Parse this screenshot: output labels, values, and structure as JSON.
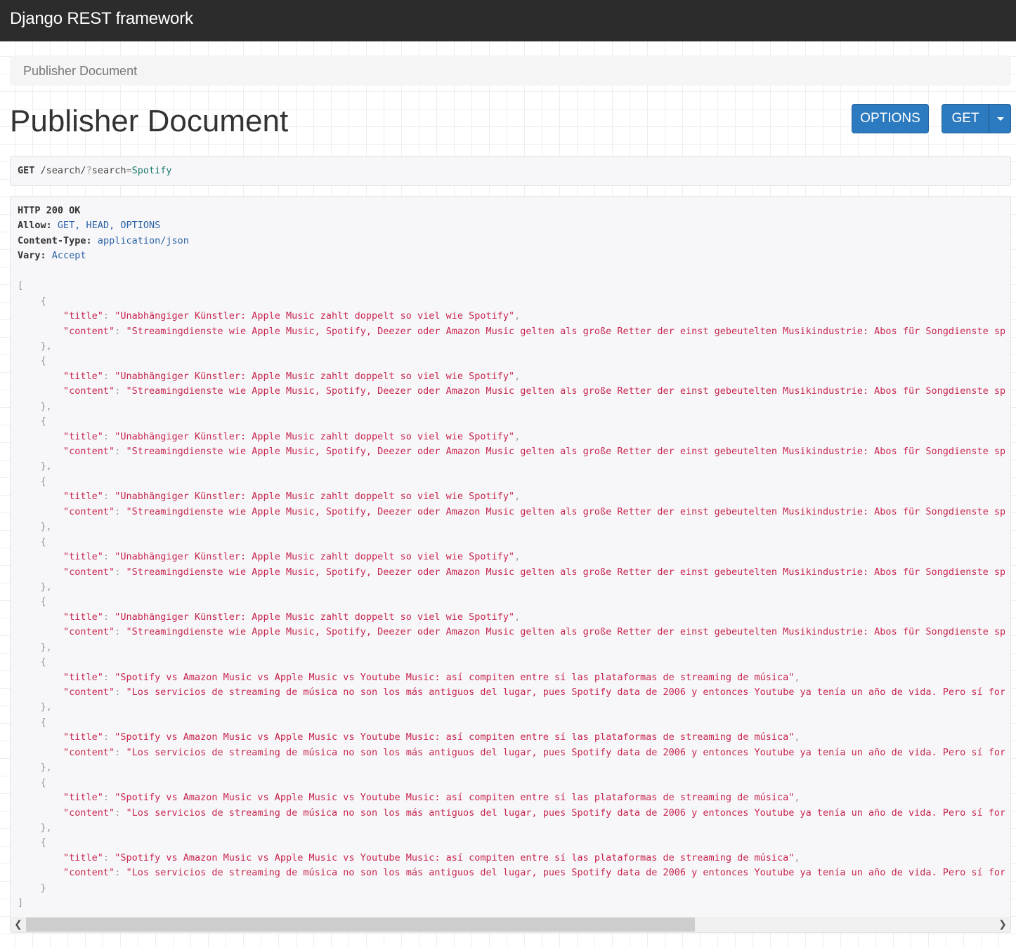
{
  "navbar": {
    "brand": "Django REST framework"
  },
  "breadcrumb": {
    "current": "Publisher Document"
  },
  "page": {
    "title": "Publisher Document"
  },
  "buttons": {
    "options_label": "OPTIONS",
    "get_label": "GET",
    "caret_icon": "caret-down-icon"
  },
  "request": {
    "method": "GET",
    "path_prefix": "/search/",
    "query_q": "?",
    "query_key": "search",
    "query_eq": "=",
    "query_value": "Spotify"
  },
  "response": {
    "status_line": "HTTP 200 OK",
    "headers": [
      {
        "key": "Allow:",
        "value": "GET, HEAD, OPTIONS"
      },
      {
        "key": "Content-Type:",
        "value": "application/json"
      },
      {
        "key": "Vary:",
        "value": "Accept"
      }
    ],
    "items": [
      {
        "title": "Unabhängiger Künstler: Apple Music zahlt doppelt so viel wie Spotify",
        "content": "Streamingdienste wie Apple Music, Spotify, Deezer oder Amazon Music gelten als große Retter der einst gebeutelten Musikindustrie: Abos für Songdienste spülen"
      },
      {
        "title": "Unabhängiger Künstler: Apple Music zahlt doppelt so viel wie Spotify",
        "content": "Streamingdienste wie Apple Music, Spotify, Deezer oder Amazon Music gelten als große Retter der einst gebeutelten Musikindustrie: Abos für Songdienste spülen"
      },
      {
        "title": "Unabhängiger Künstler: Apple Music zahlt doppelt so viel wie Spotify",
        "content": "Streamingdienste wie Apple Music, Spotify, Deezer oder Amazon Music gelten als große Retter der einst gebeutelten Musikindustrie: Abos für Songdienste spülen"
      },
      {
        "title": "Unabhängiger Künstler: Apple Music zahlt doppelt so viel wie Spotify",
        "content": "Streamingdienste wie Apple Music, Spotify, Deezer oder Amazon Music gelten als große Retter der einst gebeutelten Musikindustrie: Abos für Songdienste spülen"
      },
      {
        "title": "Unabhängiger Künstler: Apple Music zahlt doppelt so viel wie Spotify",
        "content": "Streamingdienste wie Apple Music, Spotify, Deezer oder Amazon Music gelten als große Retter der einst gebeutelten Musikindustrie: Abos für Songdienste spülen"
      },
      {
        "title": "Unabhängiger Künstler: Apple Music zahlt doppelt so viel wie Spotify",
        "content": "Streamingdienste wie Apple Music, Spotify, Deezer oder Amazon Music gelten als große Retter der einst gebeutelten Musikindustrie: Abos für Songdienste spülen"
      },
      {
        "title": "Spotify vs Amazon Music vs Apple Music vs Youtube Music: así compiten entre sí las plataformas de streaming de música",
        "content": "Los servicios de streaming de música no son los más antiguos del lugar, pues Spotify data de 2006 y entonces Youtube ya tenía un año de vida. Pero sí forman"
      },
      {
        "title": "Spotify vs Amazon Music vs Apple Music vs Youtube Music: así compiten entre sí las plataformas de streaming de música",
        "content": "Los servicios de streaming de música no son los más antiguos del lugar, pues Spotify data de 2006 y entonces Youtube ya tenía un año de vida. Pero sí forman"
      },
      {
        "title": "Spotify vs Amazon Music vs Apple Music vs Youtube Music: así compiten entre sí las plataformas de streaming de música",
        "content": "Los servicios de streaming de música no son los más antiguos del lugar, pues Spotify data de 2006 y entonces Youtube ya tenía un año de vida. Pero sí forman"
      },
      {
        "title": "Spotify vs Amazon Music vs Apple Music vs Youtube Music: así compiten entre sí las plataformas de streaming de música",
        "content": "Los servicios de streaming de música no son los más antiguos del lugar, pues Spotify data de 2006 y entonces Youtube ya tenía un año de vida. Pero sí forman"
      }
    ]
  },
  "scrollbar": {
    "left_icon": "chevron-left-icon",
    "right_icon": "chevron-right-icon",
    "left_glyph": "❮",
    "right_glyph": "❯",
    "thumb_fraction": 0.69
  },
  "colors": {
    "navbar": "#2c2c2c",
    "button": "#2c7ac0",
    "json_string": "#c7254e",
    "header_value": "#2a62a6"
  }
}
